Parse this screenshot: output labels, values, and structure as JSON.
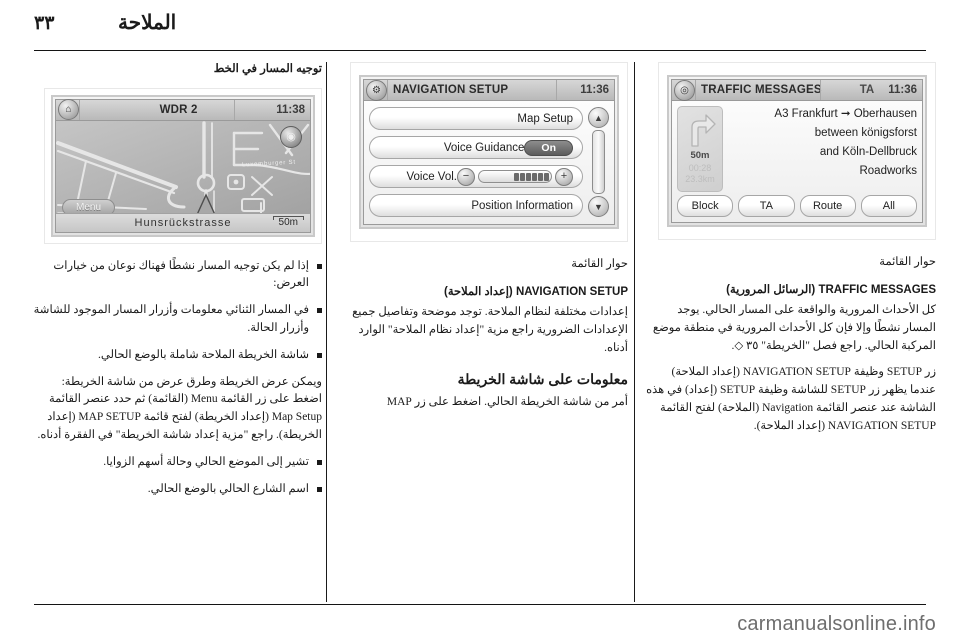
{
  "header": {
    "page_number": "٣٣",
    "chapter_title": "الملاحة"
  },
  "columns": {
    "left": {
      "figure_caption": "توجيه المسار في الخط",
      "map_screen": {
        "home_icon": "home-icon",
        "station": "WDR 2",
        "clock": "11:38",
        "compass_icon": "compass-icon",
        "menu_button": "Menu",
        "street_label": "Luxemburger St",
        "current_street": "Hunsrückstrasse",
        "scale": "50m"
      },
      "bullets": [
        "إذا لم يكن توجيه المسار نشطًا فهناك نوعان من خيارات العرض:",
        "في المسار الثنائي معلومات وأزرار المسار الموجود للشاشة وأزرار الحالة.",
        "شاشة الخريطة الملاحة شاملة بالوضع الحالي."
      ],
      "paragraph": "ويمكن عرض الخريطة وطرق عرض من شاشة الخريطة: اضغط على زر القائمة Menu (القائمة) ثم حدد عنصر القائمة Map Setup (إعداد الخريطة) لفتح قائمة MAP SETUP (إعداد الخريطة). راجع \"مزية إعداد شاشة الخريطة\" في الفقرة أدناه.",
      "tail_bullets": [
        "تشير إلى الموضع الحالي وحالة أسهم الزوايا.",
        "اسم الشارع الحالي بالوضع الحالي."
      ]
    },
    "middle": {
      "nav_setup_screen": {
        "gear_icon": "gear-icon",
        "title": "NAVIGATION SETUP",
        "clock": "11:36",
        "rows": [
          {
            "label": "Map Setup",
            "control": "none"
          },
          {
            "label": "Voice Guidance",
            "control": "toggle",
            "value": "On"
          },
          {
            "label": "Voice Vol.",
            "control": "slider",
            "minus": "−",
            "plus": "+"
          },
          {
            "label": "Position Information",
            "control": "none"
          }
        ],
        "scroll_up_icon": "chevron-up-icon",
        "scroll_down_icon": "chevron-down-icon"
      },
      "caption_label": "حوار القائمة",
      "caption_bold": "NAVIGATION SETUP (إعداد الملاحة)",
      "caption_body": "إعدادات مختلفة لنظام الملاحة. توجد موضحة وتفاصيل جميع الإعدادات الضرورية راجع مزية \"إعداد نظام الملاحة\" الوارد أدناه.",
      "section_heading": "معلومات على شاشة الخريطة",
      "section_body": "أمر من شاشة الخريطة الحالي. اضغط على زر MAP"
    },
    "right": {
      "traffic_screen": {
        "tmc_icon": "tmc-icon",
        "title": "TRAFFIC MESSAGES",
        "ta_label": "TA",
        "clock": "11:36",
        "turn_card": {
          "arrow_icon": "turn-right-icon",
          "distance": "50m",
          "eta": "00:28",
          "remaining": "23.3km"
        },
        "message_lines": [
          "A3 Frankfurt ➞ Oberhausen",
          "between königsforst",
          "and Köln-Dellbruck",
          "Roadworks"
        ],
        "buttons": [
          "Block",
          "TA",
          "Route",
          "All"
        ]
      },
      "caption_label": "حوار القائمة",
      "caption_bold": "TRAFFIC MESSAGES (الرسائل المرورية)",
      "caption_body": "كل الأحداث المرورية والواقعة على المسار الحالي. يوجد المسار نشطًا وإلا فإن كل الأحداث المرورية في منطقة موضع المركبة الحالي. راجع فصل \"الخريطة\" ٣٥ ◇.",
      "tail_body": "زر SETUP وظيفة NAVIGATION SETUP (إعداد الملاحة) عندما يظهر زر SETUP للشاشة وظيفة SETUP (إعداد) في هذه الشاشة عند عنصر القائمة Navigation (الملاحة) لفتح القائمة NAVIGATION SETUP (إعداد الملاحة)."
    }
  },
  "footer": {
    "watermark": "carmanualsonline.info"
  }
}
